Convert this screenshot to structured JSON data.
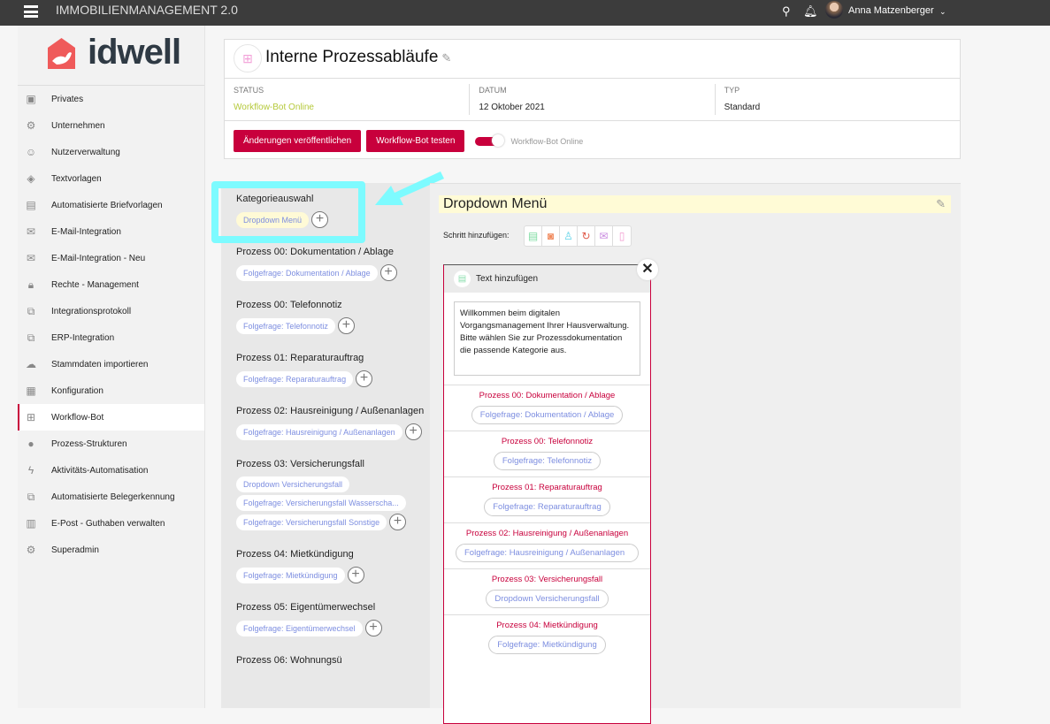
{
  "topbar": {
    "title": "IMMOBILIENMANAGEMENT 2.0",
    "user": "Anna Matzenberger"
  },
  "logo": {
    "text": "idwell"
  },
  "sidebar": {
    "items": [
      {
        "label": "Privates",
        "icon": "contact-card-icon"
      },
      {
        "label": "Unternehmen",
        "icon": "gear-icon"
      },
      {
        "label": "Nutzerverwaltung",
        "icon": "users-icon"
      },
      {
        "label": "Textvorlagen",
        "icon": "layers-icon"
      },
      {
        "label": "Automatisierte Briefvorlagen",
        "icon": "document-icon"
      },
      {
        "label": "E-Mail-Integration",
        "icon": "mail-icon"
      },
      {
        "label": "E-Mail-Integration - Neu",
        "icon": "mail-icon"
      },
      {
        "label": "Rechte - Management",
        "icon": "lock-icon"
      },
      {
        "label": "Integrationsprotokoll",
        "icon": "hierarchy-icon"
      },
      {
        "label": "ERP-Integration",
        "icon": "hierarchy-icon"
      },
      {
        "label": "Stammdaten importieren",
        "icon": "cloud-upload-icon"
      },
      {
        "label": "Konfiguration",
        "icon": "grid-icon"
      },
      {
        "label": "Workflow-Bot",
        "icon": "workflow-icon",
        "active": true
      },
      {
        "label": "Prozess-Strukturen",
        "icon": "shapes-icon"
      },
      {
        "label": "Aktivitäts-Automatisation",
        "icon": "lightning-icon"
      },
      {
        "label": "Automatisierte Belegerkennung",
        "icon": "hierarchy-icon"
      },
      {
        "label": "E-Post - Guthaben verwalten",
        "icon": "mailbox-icon"
      },
      {
        "label": "Superadmin",
        "icon": "gear-icon"
      }
    ]
  },
  "header": {
    "title": "Interne Prozessabläufe",
    "status_label": "STATUS",
    "status_value": "Workflow-Bot Online",
    "datum_label": "DATUM",
    "datum_value": "12 Oktober 2021",
    "typ_label": "TYP",
    "typ_value": "Standard",
    "publish_button": "Änderungen veröffentlichen",
    "test_button": "Workflow-Bot testen",
    "toggle_label": "Workflow-Bot Online",
    "toggle_on": true,
    "status_color": "#b5c93a",
    "accent": "#c8003c"
  },
  "groups": [
    {
      "title": "Kategorieauswahl",
      "chips": [
        {
          "label": "Dropdown Menü",
          "yellow": true
        }
      ]
    },
    {
      "title": "Prozess 00: Dokumentation / Ablage",
      "chips": [
        {
          "label": "Folgefrage: Dokumentation / Ablage"
        }
      ]
    },
    {
      "title": "Prozess 00: Telefonnotiz",
      "chips": [
        {
          "label": "Folgefrage: Telefonnotiz"
        }
      ]
    },
    {
      "title": "Prozess 01: Reparaturauftrag",
      "chips": [
        {
          "label": "Folgefrage: Reparaturauftrag"
        }
      ]
    },
    {
      "title": "Prozess 02: Hausreinigung / Außenanlagen",
      "chips": [
        {
          "label": "Folgefrage: Hausreinigung / Außenanlagen"
        }
      ]
    },
    {
      "title": "Prozess 03: Versicherungsfall",
      "chips": [
        {
          "label": "Dropdown Versicherungsfall"
        },
        {
          "label": "Folgefrage: Versicherungsfall Wasserscha..."
        },
        {
          "label": "Folgefrage: Versicherungsfall Sonstige"
        }
      ]
    },
    {
      "title": "Prozess 04: Mietkündigung",
      "chips": [
        {
          "label": "Folgefrage: Mietkündigung"
        }
      ]
    },
    {
      "title": "Prozess 05: Eigentümerwechsel",
      "chips": [
        {
          "label": "Folgefrage: Eigentümerwechsel"
        }
      ]
    },
    {
      "title": "Prozess 06: Wohnungsü",
      "chips": []
    }
  ],
  "editor": {
    "title": "Dropdown Menü",
    "step_label": "Schritt hinzufügen:",
    "steps": [
      {
        "icon": "text-icon",
        "glyph": "▤",
        "color": "#7ddba0"
      },
      {
        "icon": "camera-icon",
        "glyph": "◙",
        "color": "#f08a5d"
      },
      {
        "icon": "person-icon",
        "glyph": "♙",
        "color": "#5fd3e8"
      },
      {
        "icon": "redo-icon",
        "glyph": "↻",
        "color": "#e05a4a"
      },
      {
        "icon": "mail-icon",
        "glyph": "✉",
        "color": "#c98be0"
      },
      {
        "icon": "document-icon",
        "glyph": "▯",
        "color": "#f29ad0"
      }
    ],
    "bot_block": {
      "title": "Text hinzufügen",
      "message": "Willkommen beim digitalen Vorgangsmanagement Ihrer Hausverwaltung. Bitte wählen Sie zur Prozessdokumentation die passende Kategorie aus.",
      "options": [
        {
          "process": "Prozess 00: Dokumentation / Ablage",
          "chip": "Folgefrage: Dokumentation / Ablage"
        },
        {
          "process": "Prozess 00: Telefonnotiz",
          "chip": "Folgefrage: Telefonnotiz"
        },
        {
          "process": "Prozess 01: Reparaturauftrag",
          "chip": "Folgefrage: Reparaturauftrag"
        },
        {
          "process": "Prozess 02: Hausreinigung / Außenanlagen",
          "chip": "Folgefrage: Hausreinigung / Außenanlagen",
          "wide": true
        },
        {
          "process": "Prozess 03: Versicherungsfall",
          "chip": "Dropdown Versicherungsfall"
        },
        {
          "process": "Prozess 04: Mietkündigung",
          "chip": "Folgefrage: Mietkündigung"
        }
      ]
    }
  }
}
